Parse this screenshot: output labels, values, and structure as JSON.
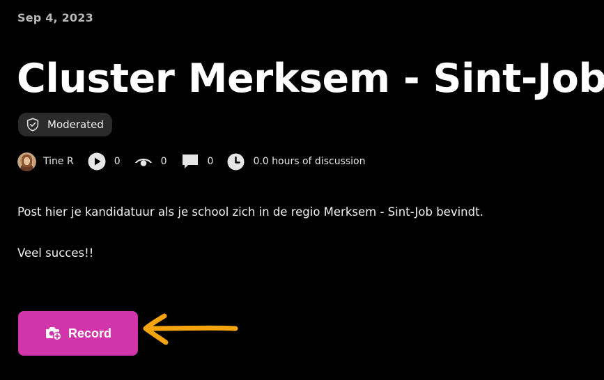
{
  "post": {
    "date": "Sep 4, 2023",
    "title": "Cluster Merksem - Sint-Job",
    "badge": "Moderated",
    "author": "Tine R",
    "plays": "0",
    "views": "0",
    "comments": "0",
    "discussion": "0.0 hours of discussion",
    "body": [
      "Post hier je kandidatuur als je school zich in de regio Merksem - Sint-Job bevindt.",
      "Veel succes!!"
    ]
  },
  "actions": {
    "record_label": "Record"
  },
  "icons": {
    "badge": "shield-check-icon",
    "play": "play-icon",
    "views": "eye-icon",
    "comments": "speech-bubble-icon",
    "time": "clock-icon",
    "record": "camera-plus-icon",
    "annotation": "arrow-left-icon"
  },
  "colors": {
    "background": "#000000",
    "accent": "#d235a9",
    "annotation": "#f5a40e",
    "badge_bg": "#2a2a2a"
  }
}
